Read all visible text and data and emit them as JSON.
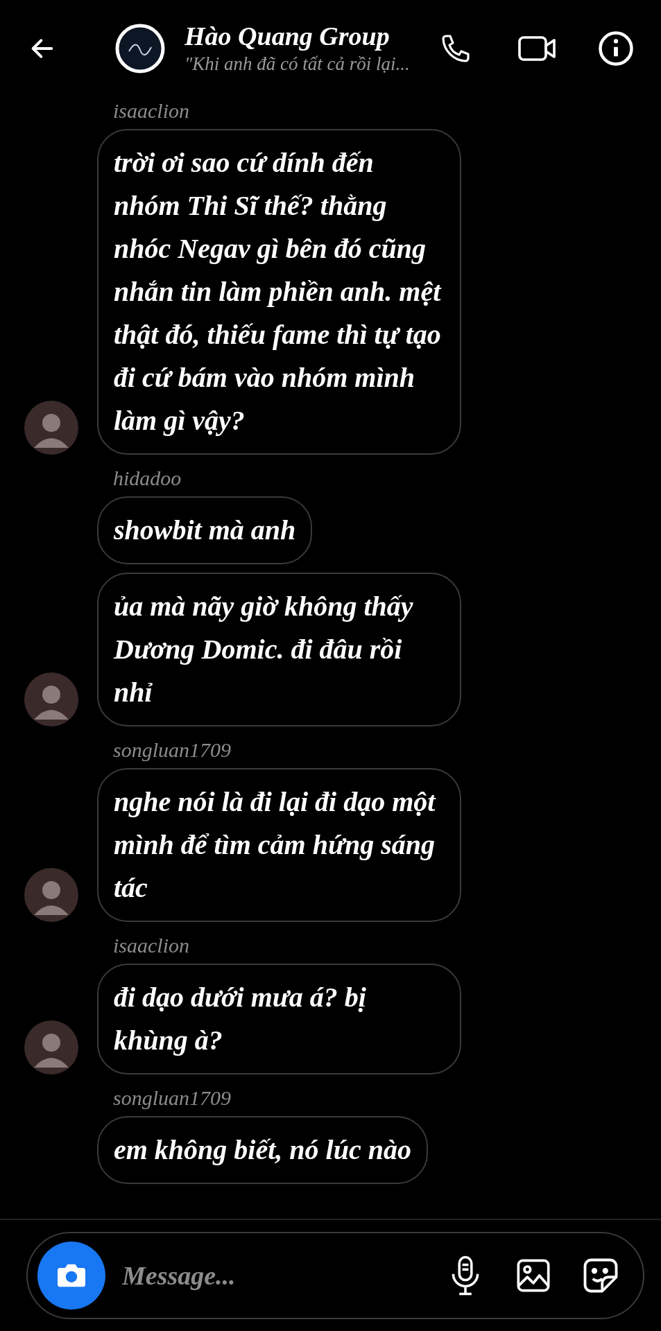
{
  "header": {
    "title": "Hào Quang Group",
    "subtitle": "\"Khi anh đã có tất cả rồi lại..."
  },
  "groups": [
    {
      "sender": "isaaclion",
      "avatar_shown": true,
      "messages": [
        "trời ơi sao cứ dính đến nhóm Thi Sĩ thế? thằng nhóc Negav gì bên đó cũng nhắn tin làm phiền anh. mệt thật đó, thiếu fame thì tự tạo đi cứ bám vào nhóm mình làm gì vậy?"
      ]
    },
    {
      "sender": "hidadoo",
      "avatar_shown": true,
      "messages": [
        "showbit mà anh",
        "ủa mà nãy giờ không thấy Dương Domic. đi đâu rồi nhỉ"
      ]
    },
    {
      "sender": "songluan1709",
      "avatar_shown": true,
      "messages": [
        "nghe nói là đi lại đi dạo một mình để tìm cảm hứng sáng tác"
      ]
    },
    {
      "sender": "isaaclion",
      "avatar_shown": true,
      "messages": [
        "đi dạo dưới mưa á? bị khùng à?"
      ]
    },
    {
      "sender": "songluan1709",
      "avatar_shown": false,
      "messages": [
        "em không biết, nó lúc nào"
      ]
    }
  ],
  "composer": {
    "placeholder": "Message..."
  }
}
